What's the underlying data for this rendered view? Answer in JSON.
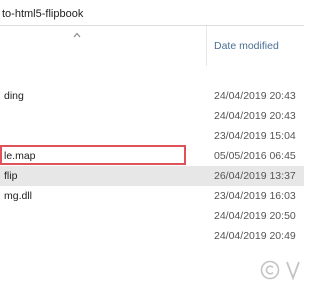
{
  "address_bar": {
    "path_text": "to-html5-flipbook"
  },
  "header": {
    "date_modified_label": "Date modified",
    "sort_icon": "chevron-up-icon"
  },
  "files": [
    {
      "name": "",
      "date": ""
    },
    {
      "name": "ding",
      "date": "24/04/2019 20:43"
    },
    {
      "name": "",
      "date": "24/04/2019 20:43"
    },
    {
      "name": "",
      "date": "23/04/2019 15:04"
    },
    {
      "name": "le.map",
      "date": "05/05/2016 06:45"
    },
    {
      "name": "flip",
      "date": "26/04/2019 13:37",
      "selected": true
    },
    {
      "name": "mg.dll",
      "date": "23/04/2019 16:03"
    },
    {
      "name": "",
      "date": "24/04/2019 20:50"
    },
    {
      "name": "",
      "date": "24/04/2019 20:49"
    }
  ],
  "highlight": {
    "color": "#e0525a"
  },
  "watermark": {
    "icons": [
      "copyright-icon",
      "brand-logo-icon"
    ],
    "color": "#c4c4c4"
  }
}
